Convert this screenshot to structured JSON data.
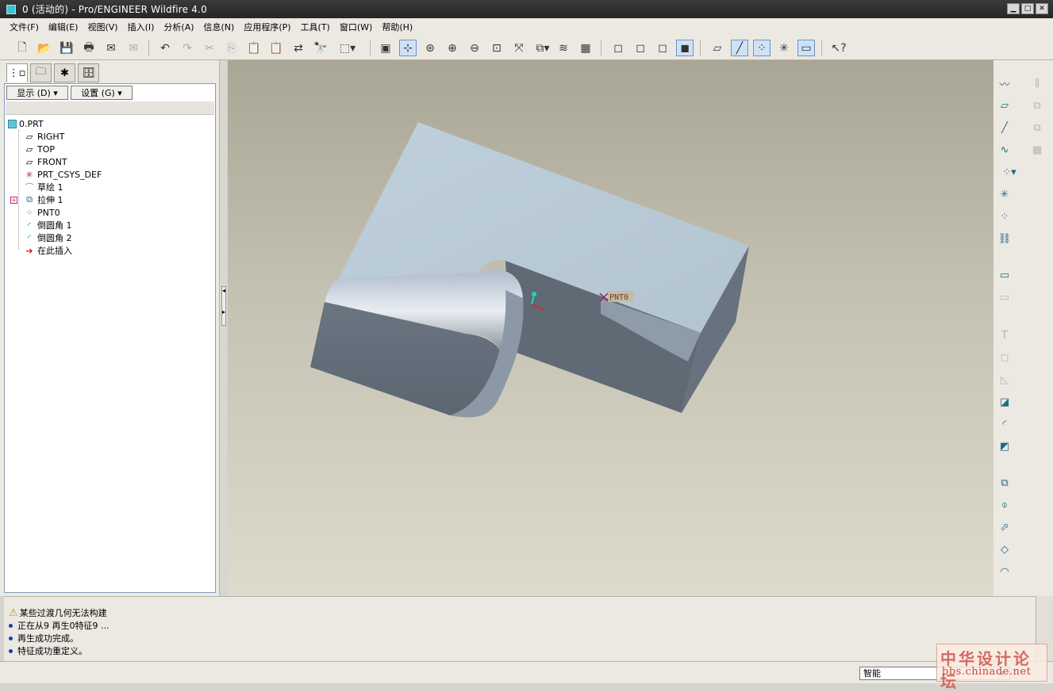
{
  "window": {
    "title": "0 (活动的) - Pro/ENGINEER Wildfire 4.0"
  },
  "menu": [
    "文件(F)",
    "编辑(E)",
    "视图(V)",
    "插入(I)",
    "分析(A)",
    "信息(N)",
    "应用程序(P)",
    "工具(T)",
    "窗口(W)",
    "帮助(H)"
  ],
  "panel": {
    "display_label": "显示 (D)",
    "settings_label": "设置 (G)",
    "tree": [
      {
        "label": "0.PRT",
        "icon": "part-icon",
        "level": 0
      },
      {
        "label": "RIGHT",
        "icon": "datum-plane-icon",
        "level": 1
      },
      {
        "label": "TOP",
        "icon": "datum-plane-icon",
        "level": 1
      },
      {
        "label": "FRONT",
        "icon": "datum-plane-icon",
        "level": 1
      },
      {
        "label": "PRT_CSYS_DEF",
        "icon": "csys-icon",
        "level": 1
      },
      {
        "label": "草绘 1",
        "icon": "sketch-icon",
        "level": 1
      },
      {
        "label": "拉伸 1",
        "icon": "extrude-icon",
        "level": 1
      },
      {
        "label": "PNT0",
        "icon": "datum-point-icon",
        "level": 1
      },
      {
        "label": "倒圆角 1",
        "icon": "round-icon",
        "level": 1
      },
      {
        "label": "倒圆角 2",
        "icon": "round-icon",
        "level": 1
      },
      {
        "label": "在此插入",
        "icon": "insert-here-arrow-icon",
        "level": 1
      }
    ]
  },
  "viewport": {
    "point_label": "PNT0"
  },
  "messages": [
    {
      "text": "某些过渡几何无法构建",
      "type": "warning"
    },
    {
      "text": "正在从9 再生0特征9 ...",
      "type": "info"
    },
    {
      "text": "再生成功完成。",
      "type": "info"
    },
    {
      "text": "特征成功重定义。",
      "type": "info"
    }
  ],
  "status": {
    "filter_value": "智能"
  },
  "watermark": {
    "line1": "中华设计论坛",
    "line2": "bbs.chinade.net"
  },
  "colors": {
    "accent": "#1c6b8a",
    "active_toggle": "#cfe2f5"
  }
}
